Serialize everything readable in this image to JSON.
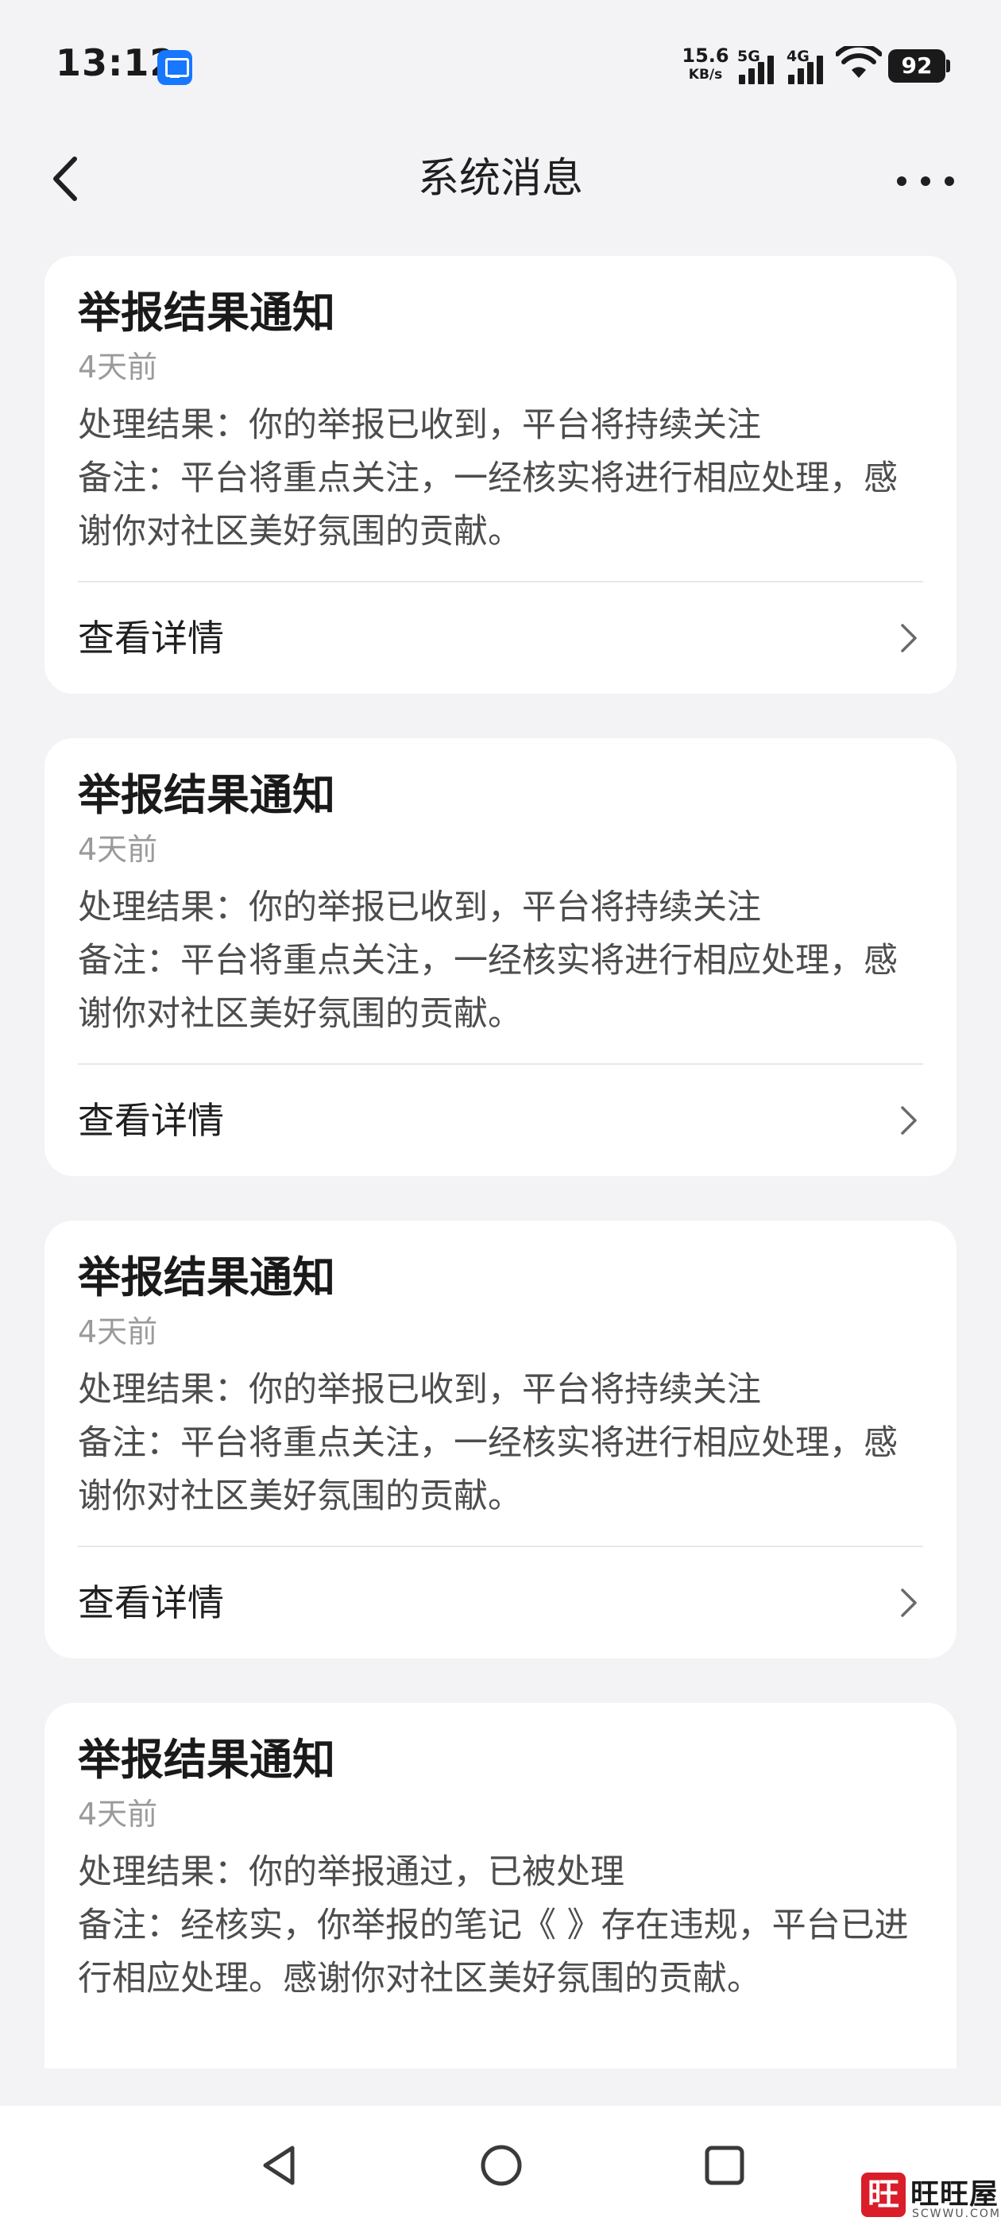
{
  "status_bar": {
    "time": "13:12",
    "app_icon": "screen-cast-icon",
    "net_speed_value": "15.6",
    "net_speed_unit": "KB/s",
    "signal_1_label": "5G",
    "signal_2_label": "4G",
    "battery": "92"
  },
  "header": {
    "title": "系统消息",
    "back_icon": "chevron-left-icon",
    "more_icon": "more-dots-icon"
  },
  "messages": [
    {
      "title": "举报结果通知",
      "time": "4天前",
      "line1": "处理结果：你的举报已收到，平台将持续关注",
      "line2": "备注：平台将重点关注，一经核实将进行相应处理，感谢你对社区美好氛围的贡献。",
      "action": "查看详情"
    },
    {
      "title": "举报结果通知",
      "time": "4天前",
      "line1": "处理结果：你的举报已收到，平台将持续关注",
      "line2": "备注：平台将重点关注，一经核实将进行相应处理，感谢你对社区美好氛围的贡献。",
      "action": "查看详情"
    },
    {
      "title": "举报结果通知",
      "time": "4天前",
      "line1": "处理结果：你的举报已收到，平台将持续关注",
      "line2": "备注：平台将重点关注，一经核实将进行相应处理，感谢你对社区美好氛围的贡献。",
      "action": "查看详情"
    },
    {
      "title": "举报结果通知",
      "time": "4天前",
      "line1": "处理结果：你的举报通过，已被处理",
      "line2": "备注：经核实，你举报的笔记《 》存在违规，平台已进行相应处理。感谢你对社区美好氛围的贡献。"
    }
  ],
  "nav_bar": {
    "back": "triangle-back-icon",
    "home": "circle-home-icon",
    "recents": "square-recents-icon"
  },
  "watermark": {
    "seal": "旺",
    "text": "旺旺屋",
    "sub": "SCWWU.COM"
  }
}
